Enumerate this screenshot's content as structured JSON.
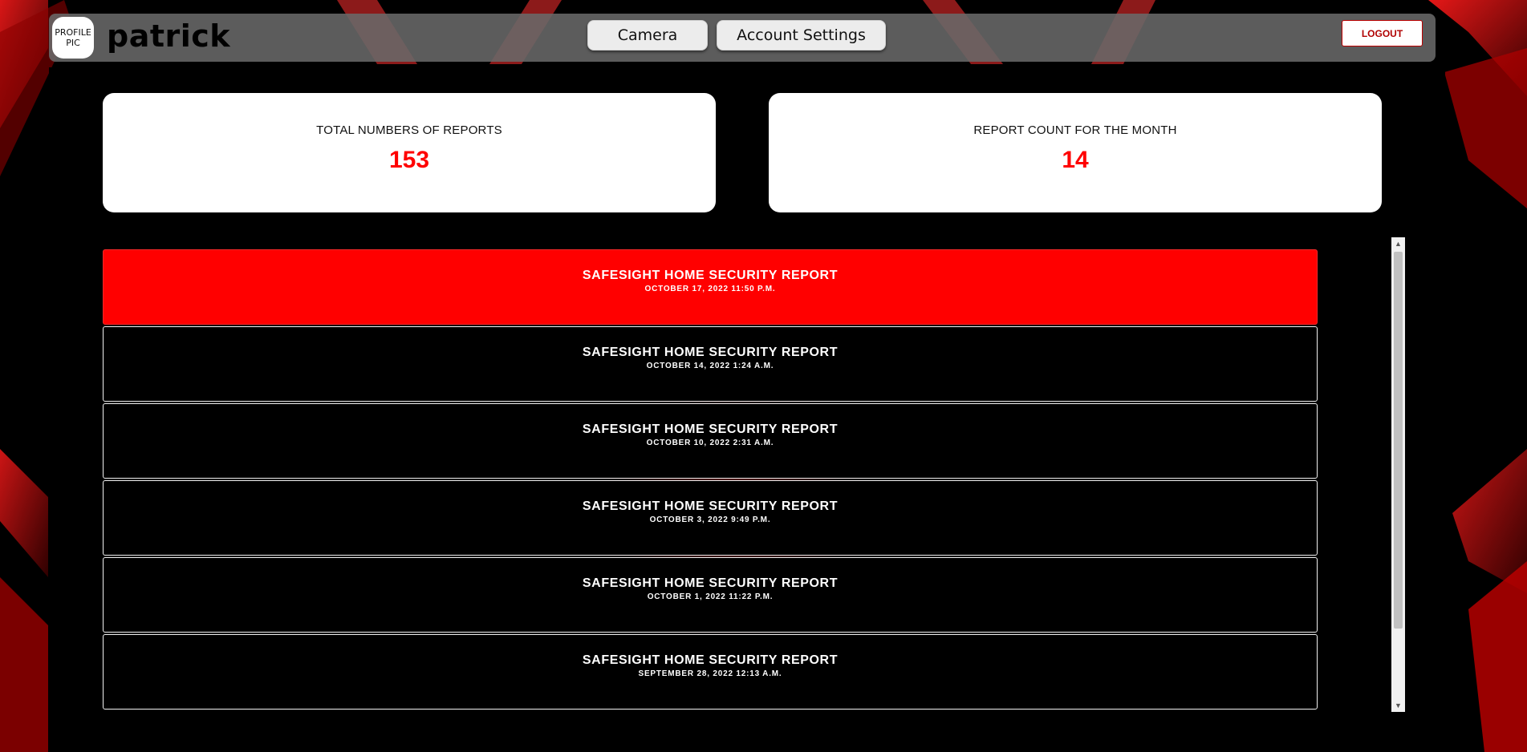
{
  "header": {
    "avatar_text_line1": "PROFILE",
    "avatar_text_line2": "PIC",
    "username": "patrick",
    "nav": {
      "camera": "Camera",
      "account_settings": "Account Settings"
    },
    "logout": "LOGOUT"
  },
  "stats": {
    "total": {
      "label": "TOTAL NUMBERS OF REPORTS",
      "value": "153"
    },
    "month": {
      "label": "REPORT COUNT FOR THE MONTH",
      "value": "14"
    }
  },
  "reports": [
    {
      "title": "SAFESIGHT HOME SECURITY REPORT",
      "date": "OCTOBER 17, 2022 11:50 P.M."
    },
    {
      "title": "SAFESIGHT HOME SECURITY REPORT",
      "date": "OCTOBER 14, 2022 1:24 A.M."
    },
    {
      "title": "SAFESIGHT HOME SECURITY REPORT",
      "date": "OCTOBER 10, 2022 2:31 A.M."
    },
    {
      "title": "SAFESIGHT HOME SECURITY REPORT",
      "date": "OCTOBER 3, 2022 9:49 P.M."
    },
    {
      "title": "SAFESIGHT HOME SECURITY REPORT",
      "date": "OCTOBER 1, 2022 11:22 P.M."
    },
    {
      "title": "SAFESIGHT HOME SECURITY REPORT",
      "date": "SEPTEMBER 28, 2022 12:13 A.M."
    }
  ],
  "colors": {
    "accent": "#ff0000",
    "background": "#000000",
    "header_bar": "#696969"
  }
}
